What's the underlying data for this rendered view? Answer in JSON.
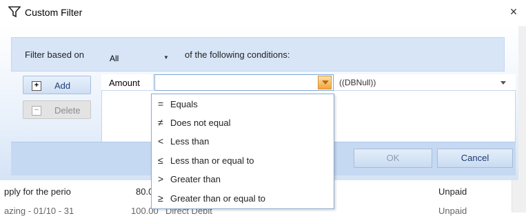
{
  "dialog": {
    "title": "Custom Filter",
    "close_glyph": "×",
    "filter_based_on_label": "Filter based on",
    "logic_value": "All",
    "conditions_suffix": "of the following conditions:",
    "add_label": "Add",
    "delete_label": "Delete",
    "condition": {
      "field": "Amount",
      "operator": "",
      "value": "((DBNull))"
    },
    "ok_label": "OK",
    "cancel_label": "Cancel"
  },
  "operator_options": [
    {
      "symbol": "=",
      "label": "Equals"
    },
    {
      "symbol": "≠",
      "label": "Does not equal"
    },
    {
      "symbol": "<",
      "label": "Less than"
    },
    {
      "symbol": "≤",
      "label": "Less than or equal to"
    },
    {
      "symbol": ">",
      "label": "Greater than"
    },
    {
      "symbol": "≥",
      "label": "Greater than or equal to"
    }
  ],
  "background_rows": [
    {
      "description": "pply for the perio",
      "amount": "80.0",
      "status": "Unpaid"
    },
    {
      "description": "azing - 01/10 - 31",
      "amount": "100.00",
      "method": "Direct Debit",
      "status": "Unpaid"
    }
  ],
  "icons": {
    "title": "filter-funnel-icon",
    "add": "plus-icon",
    "delete": "minus-icon",
    "operator_dropdown": "chevron-down-icon",
    "value_dropdown": "chevron-down-icon"
  }
}
